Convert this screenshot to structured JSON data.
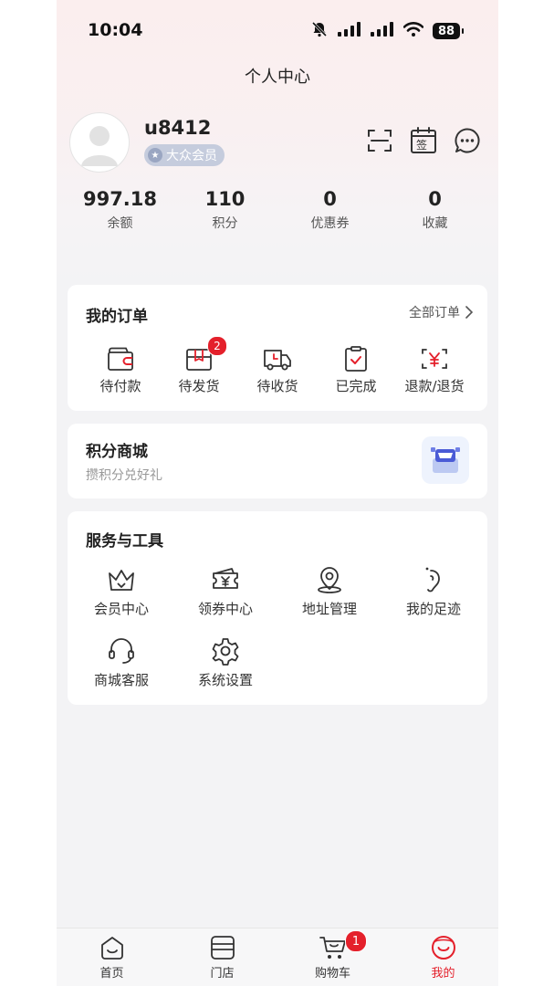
{
  "status_bar": {
    "time": "10:04",
    "battery": "88",
    "icons": [
      "bell-mute-icon",
      "cell-signal-icon",
      "cell-signal-icon",
      "wifi-icon",
      "battery-icon"
    ]
  },
  "page": {
    "title": "个人中心"
  },
  "profile": {
    "username": "u8412",
    "member_level": "大众会员",
    "actions": [
      "scan-icon",
      "sign-in-calendar-icon",
      "message-icon"
    ],
    "sign_char": "签"
  },
  "stats": [
    {
      "value": "997.18",
      "label": "余额"
    },
    {
      "value": "110",
      "label": "积分"
    },
    {
      "value": "0",
      "label": "优惠券"
    },
    {
      "value": "0",
      "label": "收藏"
    }
  ],
  "orders": {
    "title": "我的订单",
    "all_label": "全部订单",
    "items": [
      {
        "label": "待付款",
        "icon": "wallet-icon",
        "badge": ""
      },
      {
        "label": "待发货",
        "icon": "package-icon",
        "badge": "2"
      },
      {
        "label": "待收货",
        "icon": "truck-icon",
        "badge": ""
      },
      {
        "label": "已完成",
        "icon": "clipboard-check-icon",
        "badge": ""
      },
      {
        "label": "退款/退货",
        "icon": "refund-icon",
        "badge": ""
      }
    ]
  },
  "points_mall": {
    "title": "积分商城",
    "subtitle": "攒积分兑好礼"
  },
  "services": {
    "title": "服务与工具",
    "items": [
      {
        "label": "会员中心",
        "icon": "crown-icon"
      },
      {
        "label": "领券中心",
        "icon": "coupon-icon"
      },
      {
        "label": "地址管理",
        "icon": "location-pin-icon"
      },
      {
        "label": "我的足迹",
        "icon": "footprint-icon"
      },
      {
        "label": "商城客服",
        "icon": "headset-icon"
      },
      {
        "label": "系统设置",
        "icon": "gear-icon"
      }
    ]
  },
  "tabbar": {
    "items": [
      {
        "label": "首页",
        "icon": "home-icon",
        "badge": ""
      },
      {
        "label": "门店",
        "icon": "store-icon",
        "badge": ""
      },
      {
        "label": "购物车",
        "icon": "cart-icon",
        "badge": "1"
      },
      {
        "label": "我的",
        "icon": "profile-smile-icon",
        "badge": ""
      }
    ],
    "active_index": 3
  },
  "colors": {
    "accent": "#e4202b",
    "badge_bg": "#c5ccdd",
    "page_bg": "#f3f3f5"
  }
}
